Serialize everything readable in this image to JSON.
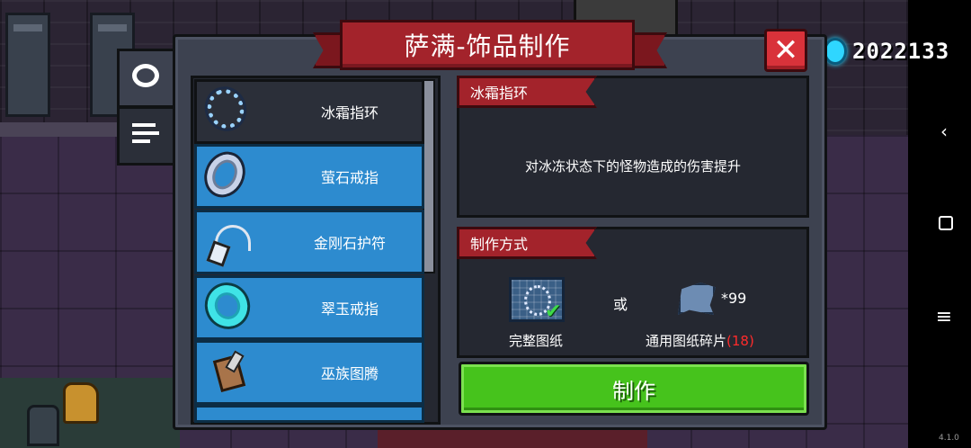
{
  "hud": {
    "gem_count": "2022133",
    "version": "4.1.0"
  },
  "nav": {
    "back": "‹",
    "menu": "≡"
  },
  "window": {
    "title": "萨满-饰品制作",
    "close": "✕"
  },
  "tabs": [
    {
      "icon": "ring-tab-icon",
      "selected": true
    },
    {
      "icon": "list-tab-icon",
      "selected": false
    }
  ],
  "items": [
    {
      "label": "冰霜指环",
      "icon": "ice-ring-icon",
      "selected": true
    },
    {
      "label": "萤石戒指",
      "icon": "fluorite-ring-icon",
      "selected": false
    },
    {
      "label": "金刚石护符",
      "icon": "diamond-amulet-icon",
      "selected": false
    },
    {
      "label": "翠玉戒指",
      "icon": "jade-ring-icon",
      "selected": false
    },
    {
      "label": "巫族图腾",
      "icon": "witch-totem-icon",
      "selected": false
    }
  ],
  "detail": {
    "name": "冰霜指环",
    "description": "对冰冻状态下的怪物造成的伤害提升"
  },
  "crafting": {
    "section_title": "制作方式",
    "blueprint_label": "完整图纸",
    "or_text": "或",
    "fragment_qty": "*99",
    "fragment_label": "通用图纸碎片",
    "fragment_owned": "(18)",
    "button_label": "制作"
  },
  "colors": {
    "accent_red": "#a3232b",
    "list_blue": "#2d8bcf",
    "craft_green": "#46c31c",
    "missing_red": "#ff2b2b"
  }
}
